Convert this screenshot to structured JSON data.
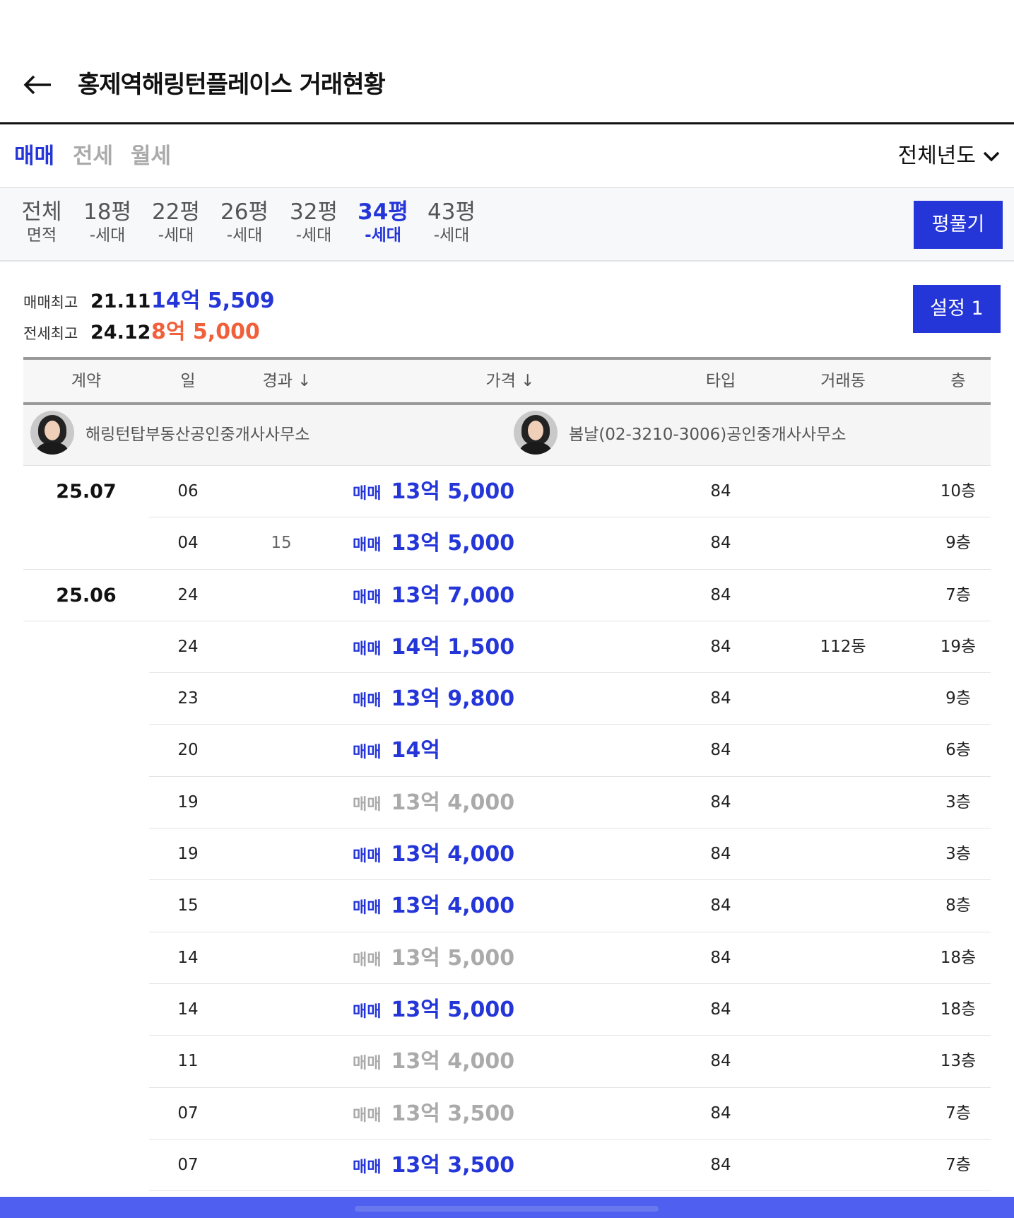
{
  "header": {
    "title": "홍제역해링턴플레이스 거래현황"
  },
  "deal_tabs": [
    {
      "label": "매매",
      "active": true
    },
    {
      "label": "전세",
      "active": false
    },
    {
      "label": "월세",
      "active": false
    }
  ],
  "year_select": {
    "label": "전체년도"
  },
  "size_tabs": [
    {
      "top": "전체",
      "bottom": "면적",
      "active": false
    },
    {
      "top": "18평",
      "bottom": "-세대",
      "active": false
    },
    {
      "top": "22평",
      "bottom": "-세대",
      "active": false
    },
    {
      "top": "26평",
      "bottom": "-세대",
      "active": false
    },
    {
      "top": "32평",
      "bottom": "-세대",
      "active": false
    },
    {
      "top": "34평",
      "bottom": "-세대",
      "active": true
    },
    {
      "top": "43평",
      "bottom": "-세대",
      "active": false
    }
  ],
  "unfold_button": "평풀기",
  "max_info": {
    "sale": {
      "label": "매매최고",
      "date": "21.11",
      "price": "14억 5,509",
      "color": "#2536d8"
    },
    "jeonse": {
      "label": "전세최고",
      "date": "24.12",
      "price": "8억 5,000",
      "color": "#f0603a"
    }
  },
  "setting_button": "설정 1",
  "table": {
    "headers": {
      "contract": "계약",
      "day": "일",
      "elapsed": "경과 ↓",
      "price": "가격 ↓",
      "type": "타입",
      "dong": "거래동",
      "floor": "층"
    },
    "agents": [
      {
        "name": "해링턴탑부동산공인중개사사무소"
      },
      {
        "name": "봄날(02-3210-3006)공인중개사사무소"
      }
    ],
    "rows": [
      {
        "month": "25.07",
        "day": "06",
        "elapsed": "",
        "kind": "매매",
        "price": "13억 5,000",
        "status": "live",
        "type": "84",
        "dong": "",
        "floor": "10층"
      },
      {
        "month": "",
        "day": "04",
        "elapsed": "15",
        "kind": "매매",
        "price": "13억 5,000",
        "status": "live",
        "type": "84",
        "dong": "",
        "floor": "9층"
      },
      {
        "month": "25.06",
        "day": "24",
        "elapsed": "",
        "kind": "매매",
        "price": "13억 7,000",
        "status": "live",
        "type": "84",
        "dong": "",
        "floor": "7층"
      },
      {
        "month": "",
        "day": "24",
        "elapsed": "",
        "kind": "매매",
        "price": "14억 1,500",
        "status": "live",
        "type": "84",
        "dong": "112동",
        "floor": "19층"
      },
      {
        "month": "",
        "day": "23",
        "elapsed": "",
        "kind": "매매",
        "price": "13억 9,800",
        "status": "live",
        "type": "84",
        "dong": "",
        "floor": "9층"
      },
      {
        "month": "",
        "day": "20",
        "elapsed": "",
        "kind": "매매",
        "price": "14억",
        "status": "live",
        "type": "84",
        "dong": "",
        "floor": "6층"
      },
      {
        "month": "",
        "day": "19",
        "elapsed": "",
        "kind": "매매",
        "price": "13억 4,000",
        "status": "cancel",
        "type": "84",
        "dong": "",
        "floor": "3층"
      },
      {
        "month": "",
        "day": "19",
        "elapsed": "",
        "kind": "매매",
        "price": "13억 4,000",
        "status": "live",
        "type": "84",
        "dong": "",
        "floor": "3층"
      },
      {
        "month": "",
        "day": "15",
        "elapsed": "",
        "kind": "매매",
        "price": "13억 4,000",
        "status": "live",
        "type": "84",
        "dong": "",
        "floor": "8층"
      },
      {
        "month": "",
        "day": "14",
        "elapsed": "",
        "kind": "매매",
        "price": "13억 5,000",
        "status": "cancel",
        "type": "84",
        "dong": "",
        "floor": "18층"
      },
      {
        "month": "",
        "day": "14",
        "elapsed": "",
        "kind": "매매",
        "price": "13억 5,000",
        "status": "live",
        "type": "84",
        "dong": "",
        "floor": "18층"
      },
      {
        "month": "",
        "day": "11",
        "elapsed": "",
        "kind": "매매",
        "price": "13억 4,000",
        "status": "cancel",
        "type": "84",
        "dong": "",
        "floor": "13층"
      },
      {
        "month": "",
        "day": "07",
        "elapsed": "",
        "kind": "매매",
        "price": "13억 3,500",
        "status": "cancel",
        "type": "84",
        "dong": "",
        "floor": "7층"
      },
      {
        "month": "",
        "day": "07",
        "elapsed": "",
        "kind": "매매",
        "price": "13억 3,500",
        "status": "live",
        "type": "84",
        "dong": "",
        "floor": "7층"
      }
    ]
  },
  "colors": {
    "accent": "#2536d8",
    "jeonse": "#f0603a",
    "cancelled": "#aaaaaa"
  }
}
